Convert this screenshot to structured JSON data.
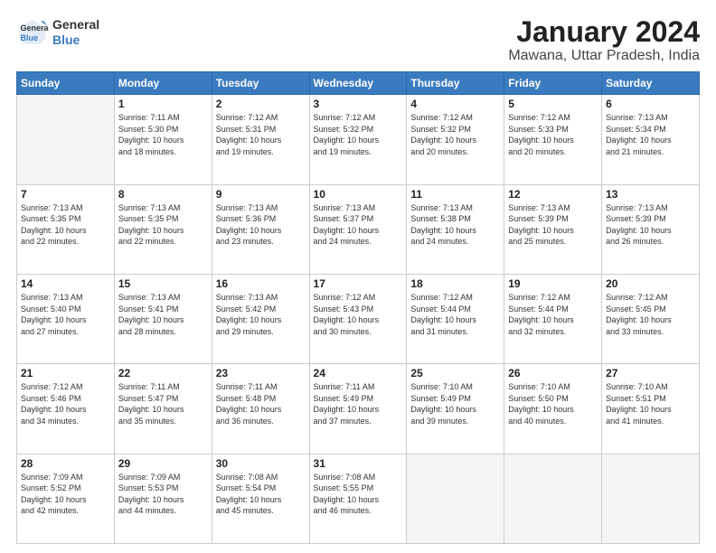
{
  "header": {
    "logo_line1": "General",
    "logo_line2": "Blue",
    "title": "January 2024",
    "subtitle": "Mawana, Uttar Pradesh, India"
  },
  "days_of_week": [
    "Sunday",
    "Monday",
    "Tuesday",
    "Wednesday",
    "Thursday",
    "Friday",
    "Saturday"
  ],
  "weeks": [
    [
      {
        "num": "",
        "info": ""
      },
      {
        "num": "1",
        "info": "Sunrise: 7:11 AM\nSunset: 5:30 PM\nDaylight: 10 hours\nand 18 minutes."
      },
      {
        "num": "2",
        "info": "Sunrise: 7:12 AM\nSunset: 5:31 PM\nDaylight: 10 hours\nand 19 minutes."
      },
      {
        "num": "3",
        "info": "Sunrise: 7:12 AM\nSunset: 5:32 PM\nDaylight: 10 hours\nand 19 minutes."
      },
      {
        "num": "4",
        "info": "Sunrise: 7:12 AM\nSunset: 5:32 PM\nDaylight: 10 hours\nand 20 minutes."
      },
      {
        "num": "5",
        "info": "Sunrise: 7:12 AM\nSunset: 5:33 PM\nDaylight: 10 hours\nand 20 minutes."
      },
      {
        "num": "6",
        "info": "Sunrise: 7:13 AM\nSunset: 5:34 PM\nDaylight: 10 hours\nand 21 minutes."
      }
    ],
    [
      {
        "num": "7",
        "info": "Sunrise: 7:13 AM\nSunset: 5:35 PM\nDaylight: 10 hours\nand 22 minutes."
      },
      {
        "num": "8",
        "info": "Sunrise: 7:13 AM\nSunset: 5:35 PM\nDaylight: 10 hours\nand 22 minutes."
      },
      {
        "num": "9",
        "info": "Sunrise: 7:13 AM\nSunset: 5:36 PM\nDaylight: 10 hours\nand 23 minutes."
      },
      {
        "num": "10",
        "info": "Sunrise: 7:13 AM\nSunset: 5:37 PM\nDaylight: 10 hours\nand 24 minutes."
      },
      {
        "num": "11",
        "info": "Sunrise: 7:13 AM\nSunset: 5:38 PM\nDaylight: 10 hours\nand 24 minutes."
      },
      {
        "num": "12",
        "info": "Sunrise: 7:13 AM\nSunset: 5:39 PM\nDaylight: 10 hours\nand 25 minutes."
      },
      {
        "num": "13",
        "info": "Sunrise: 7:13 AM\nSunset: 5:39 PM\nDaylight: 10 hours\nand 26 minutes."
      }
    ],
    [
      {
        "num": "14",
        "info": "Sunrise: 7:13 AM\nSunset: 5:40 PM\nDaylight: 10 hours\nand 27 minutes."
      },
      {
        "num": "15",
        "info": "Sunrise: 7:13 AM\nSunset: 5:41 PM\nDaylight: 10 hours\nand 28 minutes."
      },
      {
        "num": "16",
        "info": "Sunrise: 7:13 AM\nSunset: 5:42 PM\nDaylight: 10 hours\nand 29 minutes."
      },
      {
        "num": "17",
        "info": "Sunrise: 7:12 AM\nSunset: 5:43 PM\nDaylight: 10 hours\nand 30 minutes."
      },
      {
        "num": "18",
        "info": "Sunrise: 7:12 AM\nSunset: 5:44 PM\nDaylight: 10 hours\nand 31 minutes."
      },
      {
        "num": "19",
        "info": "Sunrise: 7:12 AM\nSunset: 5:44 PM\nDaylight: 10 hours\nand 32 minutes."
      },
      {
        "num": "20",
        "info": "Sunrise: 7:12 AM\nSunset: 5:45 PM\nDaylight: 10 hours\nand 33 minutes."
      }
    ],
    [
      {
        "num": "21",
        "info": "Sunrise: 7:12 AM\nSunset: 5:46 PM\nDaylight: 10 hours\nand 34 minutes."
      },
      {
        "num": "22",
        "info": "Sunrise: 7:11 AM\nSunset: 5:47 PM\nDaylight: 10 hours\nand 35 minutes."
      },
      {
        "num": "23",
        "info": "Sunrise: 7:11 AM\nSunset: 5:48 PM\nDaylight: 10 hours\nand 36 minutes."
      },
      {
        "num": "24",
        "info": "Sunrise: 7:11 AM\nSunset: 5:49 PM\nDaylight: 10 hours\nand 37 minutes."
      },
      {
        "num": "25",
        "info": "Sunrise: 7:10 AM\nSunset: 5:49 PM\nDaylight: 10 hours\nand 39 minutes."
      },
      {
        "num": "26",
        "info": "Sunrise: 7:10 AM\nSunset: 5:50 PM\nDaylight: 10 hours\nand 40 minutes."
      },
      {
        "num": "27",
        "info": "Sunrise: 7:10 AM\nSunset: 5:51 PM\nDaylight: 10 hours\nand 41 minutes."
      }
    ],
    [
      {
        "num": "28",
        "info": "Sunrise: 7:09 AM\nSunset: 5:52 PM\nDaylight: 10 hours\nand 42 minutes."
      },
      {
        "num": "29",
        "info": "Sunrise: 7:09 AM\nSunset: 5:53 PM\nDaylight: 10 hours\nand 44 minutes."
      },
      {
        "num": "30",
        "info": "Sunrise: 7:08 AM\nSunset: 5:54 PM\nDaylight: 10 hours\nand 45 minutes."
      },
      {
        "num": "31",
        "info": "Sunrise: 7:08 AM\nSunset: 5:55 PM\nDaylight: 10 hours\nand 46 minutes."
      },
      {
        "num": "",
        "info": ""
      },
      {
        "num": "",
        "info": ""
      },
      {
        "num": "",
        "info": ""
      }
    ]
  ]
}
